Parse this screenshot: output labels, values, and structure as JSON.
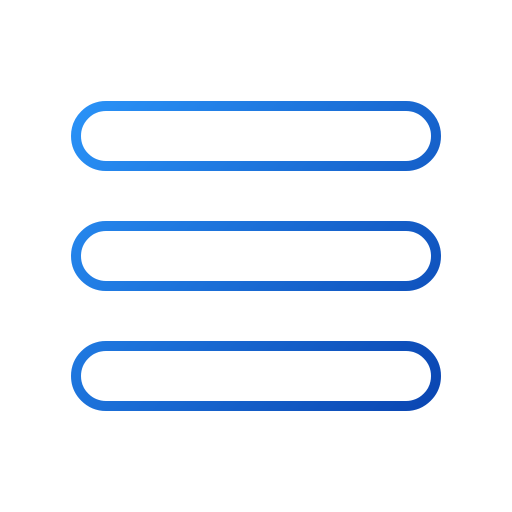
{
  "icon": {
    "name": "hamburger-menu-icon",
    "gradient": {
      "start_color": "#2a93f8",
      "end_color": "#0a45b1"
    },
    "bars": [
      {
        "name": "menu-bar-top"
      },
      {
        "name": "menu-bar-middle"
      },
      {
        "name": "menu-bar-bottom"
      }
    ]
  }
}
